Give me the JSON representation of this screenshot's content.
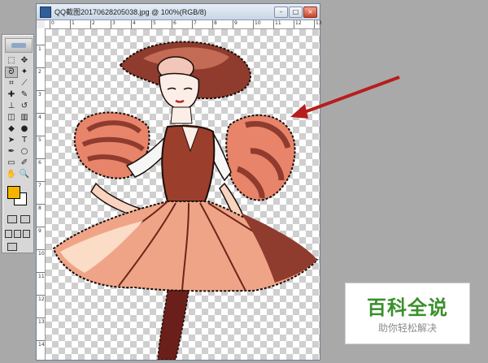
{
  "document": {
    "title": "QQ截图20170628205038.jpg @ 100%(RGB/8)",
    "ruler_top_numbers": [
      "0",
      "1",
      "2",
      "3",
      "4",
      "5",
      "6",
      "7",
      "8",
      "9",
      "10",
      "11",
      "12",
      "13"
    ],
    "ruler_left_numbers": [
      "1",
      "2",
      "3",
      "4",
      "5",
      "6",
      "7",
      "8",
      "9",
      "10",
      "11",
      "12",
      "13",
      "14"
    ]
  },
  "window_buttons": {
    "minimize": "–",
    "maximize": "□",
    "close": "×"
  },
  "colors": {
    "foreground": "#f4b400",
    "background": "#ffffff",
    "annotation_arrow": "#b81d1d",
    "watermark_green": "#3a8f2c"
  },
  "tools": [
    {
      "name": "marquee-tool-icon",
      "glyph": "⬚"
    },
    {
      "name": "move-tool-icon",
      "glyph": "✥"
    },
    {
      "name": "lasso-tool-icon",
      "glyph": "ᘐ"
    },
    {
      "name": "magic-wand-tool-icon",
      "glyph": "✦"
    },
    {
      "name": "crop-tool-icon",
      "glyph": "⌗"
    },
    {
      "name": "slice-tool-icon",
      "glyph": "⟋"
    },
    {
      "name": "healing-brush-tool-icon",
      "glyph": "✚"
    },
    {
      "name": "brush-tool-icon",
      "glyph": "✎"
    },
    {
      "name": "clone-stamp-tool-icon",
      "glyph": "⊥"
    },
    {
      "name": "history-brush-tool-icon",
      "glyph": "↺"
    },
    {
      "name": "eraser-tool-icon",
      "glyph": "◫"
    },
    {
      "name": "gradient-tool-icon",
      "glyph": "▥"
    },
    {
      "name": "blur-tool-icon",
      "glyph": "◆"
    },
    {
      "name": "dodge-tool-icon",
      "glyph": "●"
    },
    {
      "name": "path-selection-tool-icon",
      "glyph": "➤"
    },
    {
      "name": "type-tool-icon",
      "glyph": "T"
    },
    {
      "name": "pen-tool-icon",
      "glyph": "✒"
    },
    {
      "name": "shape-tool-icon",
      "glyph": "○"
    },
    {
      "name": "notes-tool-icon",
      "glyph": "▭"
    },
    {
      "name": "eyedropper-tool-icon",
      "glyph": "✐"
    },
    {
      "name": "hand-tool-icon",
      "glyph": "✋"
    },
    {
      "name": "zoom-tool-icon",
      "glyph": "🔍"
    }
  ],
  "watermark": {
    "title": "百科全说",
    "subtitle": "助你轻松解决"
  }
}
